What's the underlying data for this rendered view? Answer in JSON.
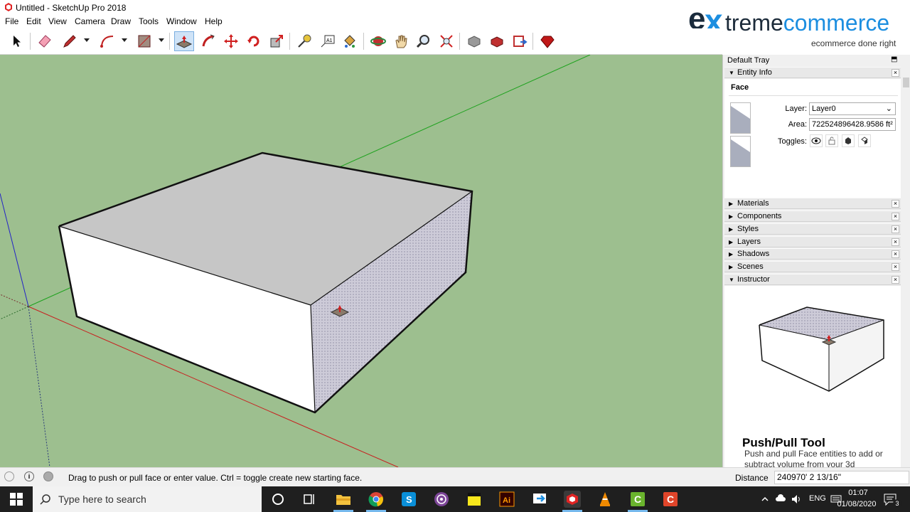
{
  "window": {
    "title": "Untitled - SketchUp Pro 2018",
    "controls": [
      "—",
      "❐",
      "✕"
    ]
  },
  "logo": {
    "e": "e",
    "x": "x",
    "rest_a": "treme",
    "rest_b": "commerce",
    "tagline": "ecommerce done right"
  },
  "menu": [
    "File",
    "Edit",
    "View",
    "Camera",
    "Draw",
    "Tools",
    "Window",
    "Help"
  ],
  "toolbar": {
    "tools": [
      "select-icon",
      "eraser-icon",
      "pencil-icon",
      "arc-icon",
      "rectangle-icon",
      "push-pull-icon",
      "follow-me-icon",
      "move-icon",
      "rotate-icon",
      "scale-icon",
      "tape-measure-icon",
      "text-icon",
      "paint-bucket-icon",
      "orbit-icon",
      "pan-icon",
      "zoom-icon",
      "zoom-extents-icon",
      "3d-warehouse-icon",
      "extension-warehouse-icon",
      "layout-icon",
      "ruby-icon"
    ],
    "active": "push-pull-icon"
  },
  "tray": {
    "title": "Default Tray",
    "pin": "⬒",
    "entity_info": {
      "header": "Entity Info",
      "type": "Face",
      "layer_label": "Layer:",
      "layer_value": "Layer0",
      "area_label": "Area:",
      "area_value": "722524896428.9586 ft²",
      "toggles_label": "Toggles:"
    },
    "panels": [
      "Materials",
      "Components",
      "Styles",
      "Layers",
      "Shadows",
      "Scenes"
    ],
    "instructor": {
      "header": "Instructor",
      "title": "Push/Pull Tool",
      "text": "Push and pull Face entities to add or subtract volume from your 3d"
    }
  },
  "status": {
    "message": "Drag to push or pull face or enter value.  Ctrl = toggle create new starting face.",
    "distance_label": "Distance",
    "distance_value": "240970' 2 13/16\""
  },
  "taskbar": {
    "search_placeholder": "Type here to search",
    "apps": [
      "cortana-icon",
      "task-view-icon",
      "file-explorer-icon",
      "chrome-icon",
      "skype-icon",
      "tor-icon",
      "sticky-notes-icon",
      "illustrator-icon",
      "app-icon",
      "sketchup-icon",
      "vlc-icon",
      "camtasia-icon",
      "camtasia-recorder-icon"
    ],
    "language": "ENG",
    "time": "01:07",
    "date": "01/08/2020",
    "notifications": "3"
  },
  "colors": {
    "viewport_bg": "#9dbf8f",
    "top_face": "#c6c6c6",
    "front_face": "#ffffff",
    "side_face": "#c9c6d6",
    "accent": "#1c8ee0"
  }
}
